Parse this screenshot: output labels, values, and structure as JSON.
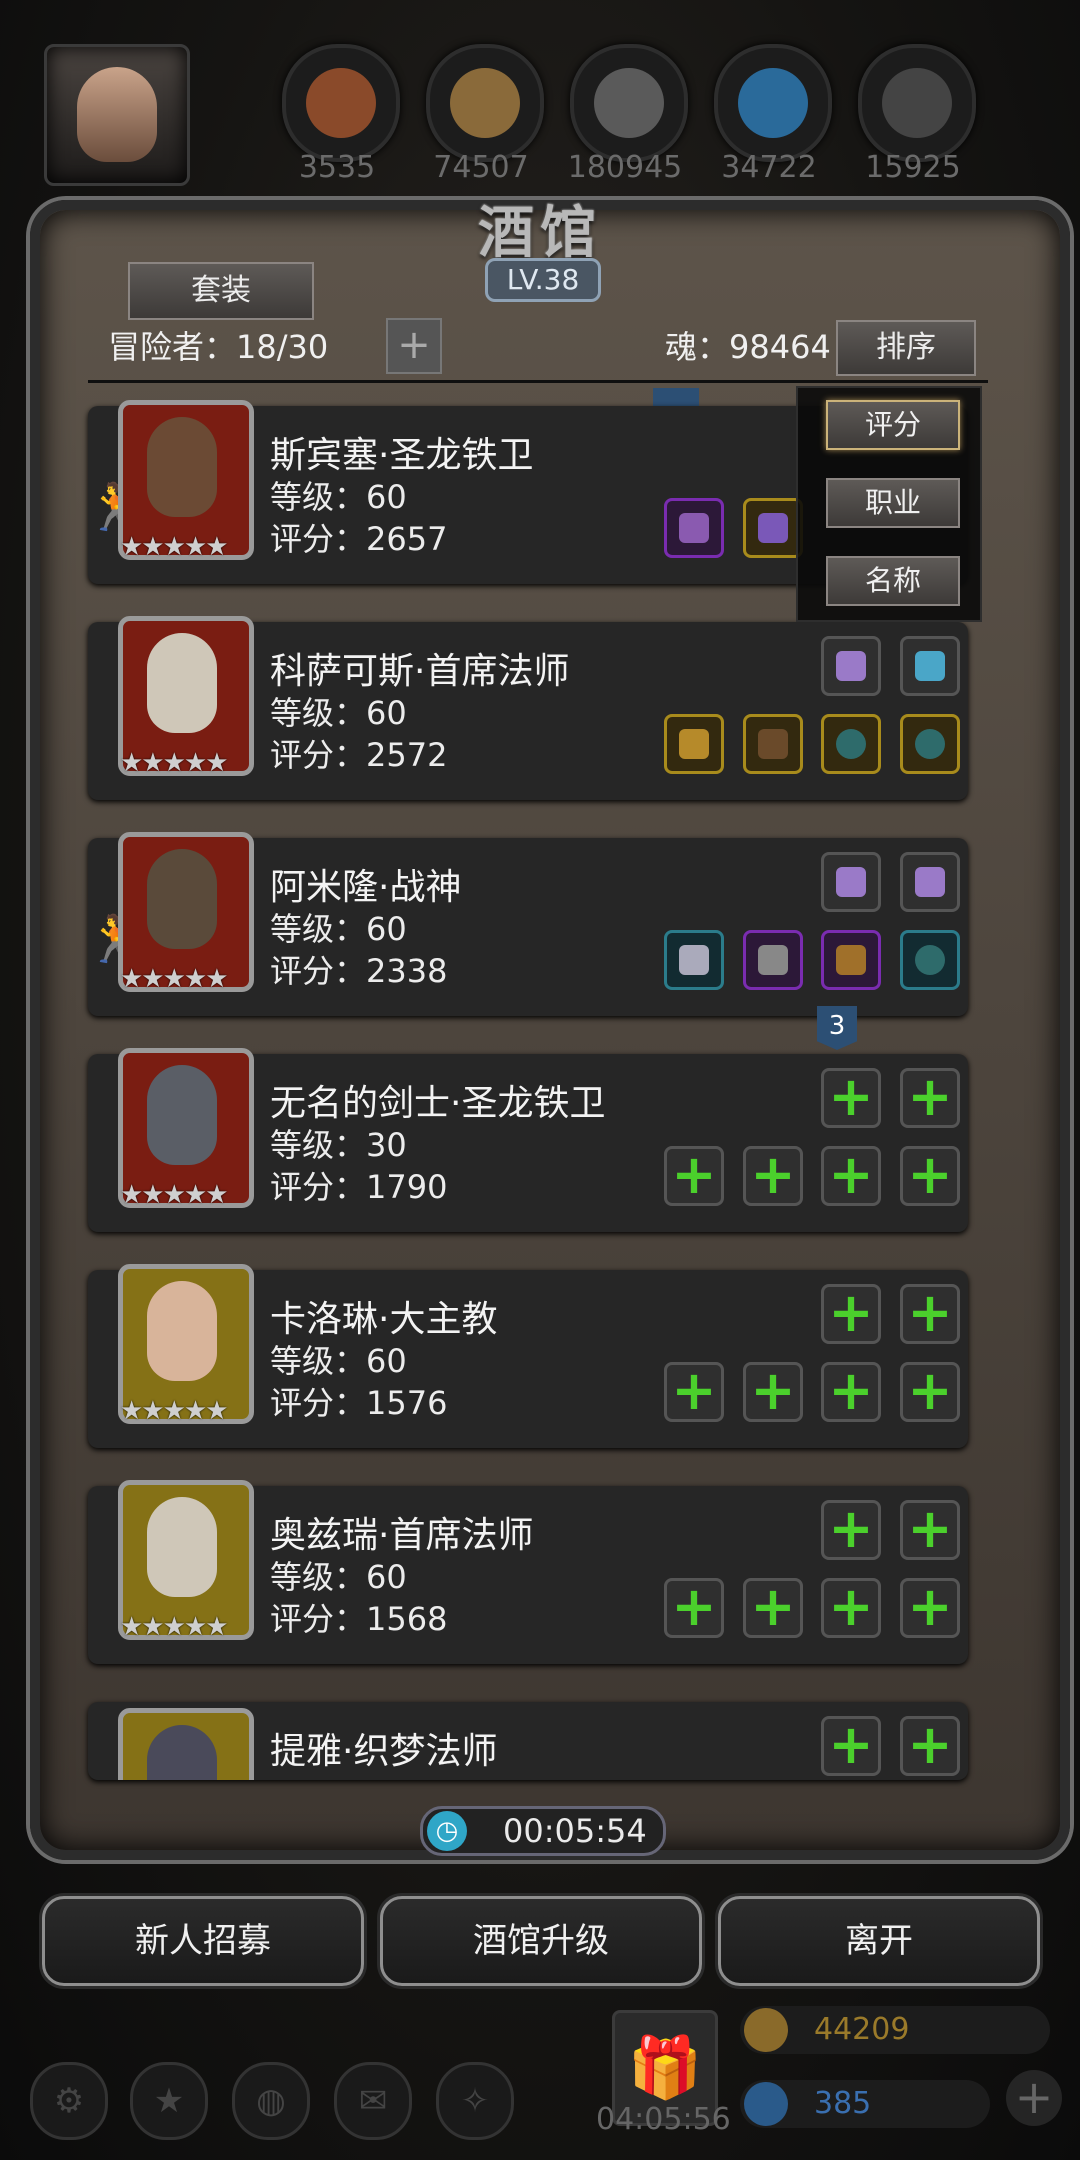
{
  "resources": [
    "3535",
    "74507",
    "180945",
    "34722",
    "15925"
  ],
  "tavern": {
    "title": "酒馆",
    "level": "LV.38"
  },
  "toolbar": {
    "set_label": "套装",
    "adventurers": "冒险者：18/30",
    "soul": "魂：98464",
    "sort_label": "排序"
  },
  "sort_menu": [
    "评分",
    "职业",
    "名称"
  ],
  "heroes": [
    {
      "name": "斯宾塞·圣龙铁卫",
      "level": "等级：60",
      "score": "评分：2657"
    },
    {
      "name": "科萨可斯·首席法师",
      "level": "等级：60",
      "score": "评分：2572"
    },
    {
      "name": "阿米隆·战神",
      "level": "等级：60",
      "score": "评分：2338"
    },
    {
      "name": "无名的剑士·圣龙铁卫",
      "level": "等级：30",
      "score": "评分：1790"
    },
    {
      "name": "卡洛琳·大主教",
      "level": "等级：60",
      "score": "评分：1576"
    },
    {
      "name": "奥兹瑞·首席法师",
      "level": "等级：60",
      "score": "评分：1568"
    },
    {
      "name": "提雅·织梦法师",
      "level": "",
      "score": ""
    }
  ],
  "stars": "★★★★★",
  "badge": "3",
  "timer": "00:05:54",
  "buttons": {
    "recruit": "新人招募",
    "upgrade": "酒馆升级",
    "leave": "离开"
  },
  "hud": {
    "gift_timer": "04:05:56",
    "gold": "44209",
    "gems": "385"
  },
  "colors": {
    "accent_green": "#4bd02c",
    "gold_text": "#d9a43a",
    "gem_text": "#3f7fd6"
  }
}
